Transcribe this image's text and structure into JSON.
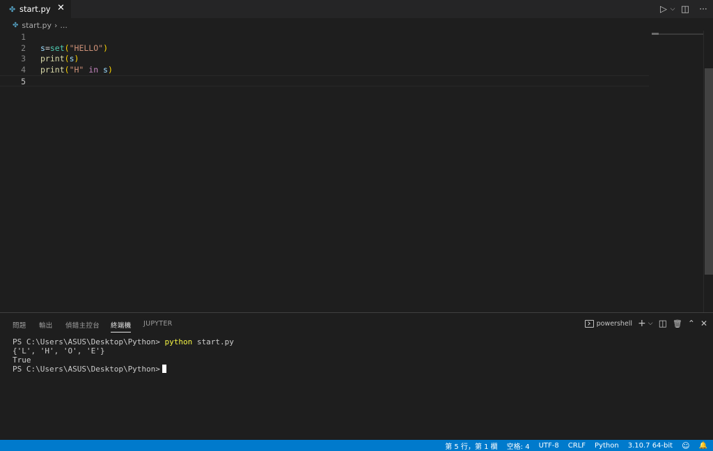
{
  "tab": {
    "filename": "start.py",
    "close_glyph": "✕"
  },
  "editor_actions": {
    "run": "▷",
    "run_menu": "⌵",
    "split": "◫",
    "more": "···"
  },
  "breadcrumb": {
    "file": "start.py",
    "separator": "›",
    "ellipsis": "..."
  },
  "code_lines": [
    {
      "num": "1",
      "tokens": []
    },
    {
      "num": "2",
      "tokens": [
        {
          "t": "s",
          "c": "t-var"
        },
        {
          "t": "=",
          "c": "t-op"
        },
        {
          "t": "set",
          "c": "t-cls"
        },
        {
          "t": "(",
          "c": "t-br"
        },
        {
          "t": "\"HELLO\"",
          "c": "t-str"
        },
        {
          "t": ")",
          "c": "t-br"
        }
      ]
    },
    {
      "num": "3",
      "tokens": [
        {
          "t": "print",
          "c": "t-fn"
        },
        {
          "t": "(",
          "c": "t-br"
        },
        {
          "t": "s",
          "c": "t-var"
        },
        {
          "t": ")",
          "c": "t-br"
        }
      ]
    },
    {
      "num": "4",
      "tokens": [
        {
          "t": "print",
          "c": "t-fn"
        },
        {
          "t": "(",
          "c": "t-br"
        },
        {
          "t": "\"H\"",
          "c": "t-str"
        },
        {
          "t": " in ",
          "c": "t-kw"
        },
        {
          "t": "s",
          "c": "t-var"
        },
        {
          "t": ")",
          "c": "t-br"
        }
      ]
    },
    {
      "num": "5",
      "tokens": []
    }
  ],
  "panel": {
    "tabs": [
      "問題",
      "輸出",
      "偵錯主控台",
      "終端機",
      "JUPYTER"
    ],
    "active_tab": "終端機",
    "shell": "powershell",
    "actions": {
      "add": "+",
      "dropdown": "⌵",
      "split": "◫",
      "trash": "🗑",
      "maximize": "⌃",
      "close": "✕"
    }
  },
  "terminal": {
    "prompt": "PS C:\\Users\\ASUS\\Desktop\\Python> ",
    "command_name": "python",
    "command_args": " start.py",
    "output": [
      "{'L', 'H', 'O', 'E'}",
      "True"
    ],
    "final_prompt": "PS C:\\Users\\ASUS\\Desktop\\Python>"
  },
  "statusbar": {
    "position": "第 5 行，第 1 欄",
    "indent": "空格: 4",
    "encoding": "UTF-8",
    "eol": "CRLF",
    "language": "Python",
    "interpreter": "3.10.7 64-bit",
    "feedback_glyph": "☺",
    "bell_glyph": "🔔"
  },
  "colors": {
    "accent": "#007acc",
    "editor_bg": "#1e1e1e",
    "tab_bar_bg": "#252526"
  }
}
